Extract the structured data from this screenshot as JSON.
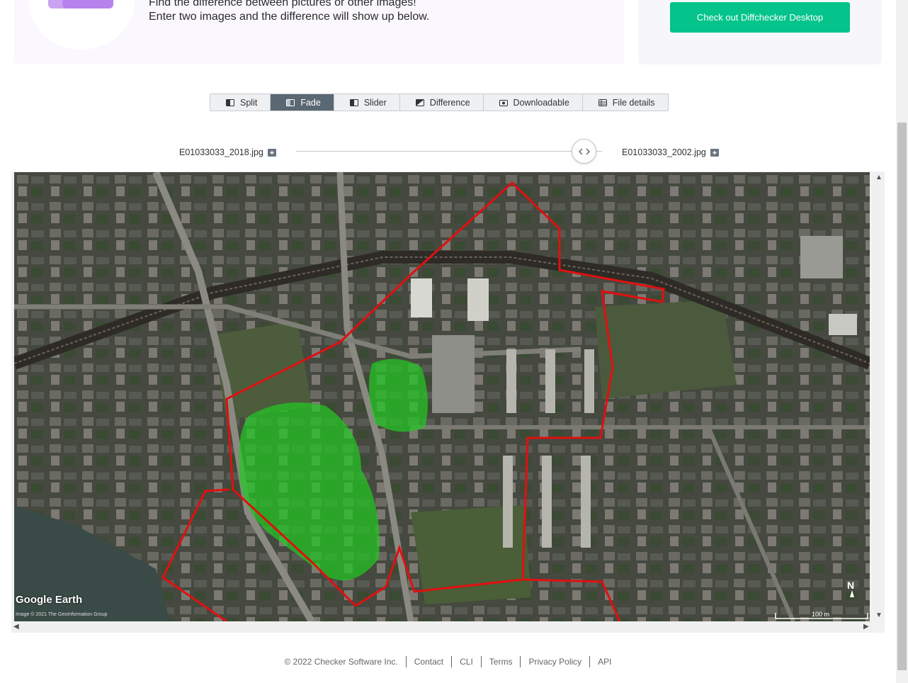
{
  "hero": {
    "line1": "Find the difference between pictures or other images!",
    "line2": "Enter two images and the difference will show up below."
  },
  "promo": {
    "button_label": "Check out Diffchecker Desktop"
  },
  "tabs": [
    {
      "label": "Split",
      "icon": "split-icon",
      "active": false
    },
    {
      "label": "Fade",
      "icon": "fade-icon",
      "active": true
    },
    {
      "label": "Slider",
      "icon": "slider-icon",
      "active": false
    },
    {
      "label": "Difference",
      "icon": "difference-icon",
      "active": false
    },
    {
      "label": "Downloadable",
      "icon": "camera-icon",
      "active": false
    },
    {
      "label": "File details",
      "icon": "table-icon",
      "active": false
    }
  ],
  "files": {
    "left_name": "E01033033_2018.jpg",
    "right_name": "E01033033_2002.jpg"
  },
  "fade": {
    "level": 0.94
  },
  "map": {
    "logo": "Google Earth",
    "credit": "Image © 2021 The GeoInformation Group",
    "scale": "100 m",
    "north": "N"
  },
  "footer": {
    "copyright": "© 2022 Checker Software Inc.",
    "links": [
      "Contact",
      "CLI",
      "Terms",
      "Privacy Policy",
      "API"
    ]
  },
  "colors": {
    "accent": "#04c48b",
    "active_tab": "#5a6873",
    "boundary": "#e01010",
    "overlay": "#22c822"
  }
}
